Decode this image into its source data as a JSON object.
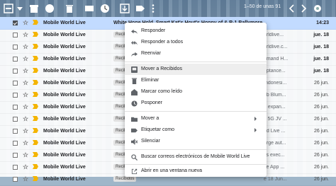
{
  "toolbar": {
    "pager": "1–50 de unas 91"
  },
  "emails": [
    {
      "sender": "Mobile World Live",
      "badge": "",
      "subject": "White Hope Hold. Smart Kat's Hout's Hoppy of & R-1 Ballymore...",
      "tail": "",
      "date": "14:23",
      "selected": true
    },
    {
      "sender": "Mobile World Live",
      "badge": "Recibidos",
      "subject": "",
      "tail": "orldlive...",
      "date": "jue. 18",
      "selected": false
    },
    {
      "sender": "Mobile World Live",
      "badge": "Recibidos",
      "subject": "",
      "tail": "orldlive.c...",
      "date": "jue. 18",
      "selected": false
    },
    {
      "sender": "Mobile World Live",
      "badge": "Recibidos",
      "subject": "",
      "tail": "emand H...",
      "date": "jue. 18",
      "selected": false
    },
    {
      "sender": "Mobile World Live",
      "badge": "Recibidos",
      "subject": "",
      "tail": "eptance...",
      "date": "jue. 18",
      "selected": false
    },
    {
      "sender": "Mobile World Live",
      "badge": "Recibidos",
      "subject": "",
      "tail": "Indonesi...",
      "date": "26 jun.",
      "selected": false
    },
    {
      "sender": "Mobile World Live",
      "badge": "Recibidos",
      "subject": "",
      "tail": "ob Blum...",
      "date": "26 jun.",
      "selected": false
    },
    {
      "sender": "Mobile World Live",
      "badge": "Recibidos",
      "subject": "",
      "tail": "u expan...",
      "date": "26 jun.",
      "selected": false
    },
    {
      "sender": "Mobile World Live",
      "badge": "Recibidos",
      "subject": "",
      "tail": "s 5G JV ...",
      "date": "26 jun.",
      "selected": false
    },
    {
      "sender": "Mobile World Live",
      "badge": "Recibidos",
      "subject": "",
      "tail": "rld Live ...",
      "date": "26 jun.",
      "selected": false
    },
    {
      "sender": "Mobile World Live",
      "badge": "Recibidos",
      "subject": "",
      "tail": "arge aut...",
      "date": "26 jun.",
      "selected": false
    },
    {
      "sender": "Mobile World Live",
      "badge": "Recibidos",
      "subject": "",
      "tail": "vs exec...",
      "date": "26 jun.",
      "selected": false
    },
    {
      "sender": "Mobile World Live",
      "badge": "Recibidos",
      "subject": "",
      "tail": "se App ...",
      "date": "26 jun.",
      "selected": false
    },
    {
      "sender": "Mobile World Live",
      "badge": "Recibidos",
      "subject": "",
      "tail": "e 18 Jun...",
      "date": "26 jun.",
      "selected": false
    }
  ],
  "menu": {
    "reply": "Responder",
    "reply_all": "Responder a todos",
    "forward": "Reenviar",
    "move_inbox": "Mover a Recibidos",
    "delete": "Eliminar",
    "mark_read": "Marcar como leído",
    "snooze": "Posponer",
    "move_to": "Mover a",
    "label_as": "Etiquetar como",
    "mute": "Silenciar",
    "search_from": "Buscar correos electrónicos de Mobile World Live",
    "open_window": "Abrir en una ventana nueva"
  },
  "colors": {
    "selected_row": "#c2dbff",
    "importance_marker": "#f4b400"
  }
}
